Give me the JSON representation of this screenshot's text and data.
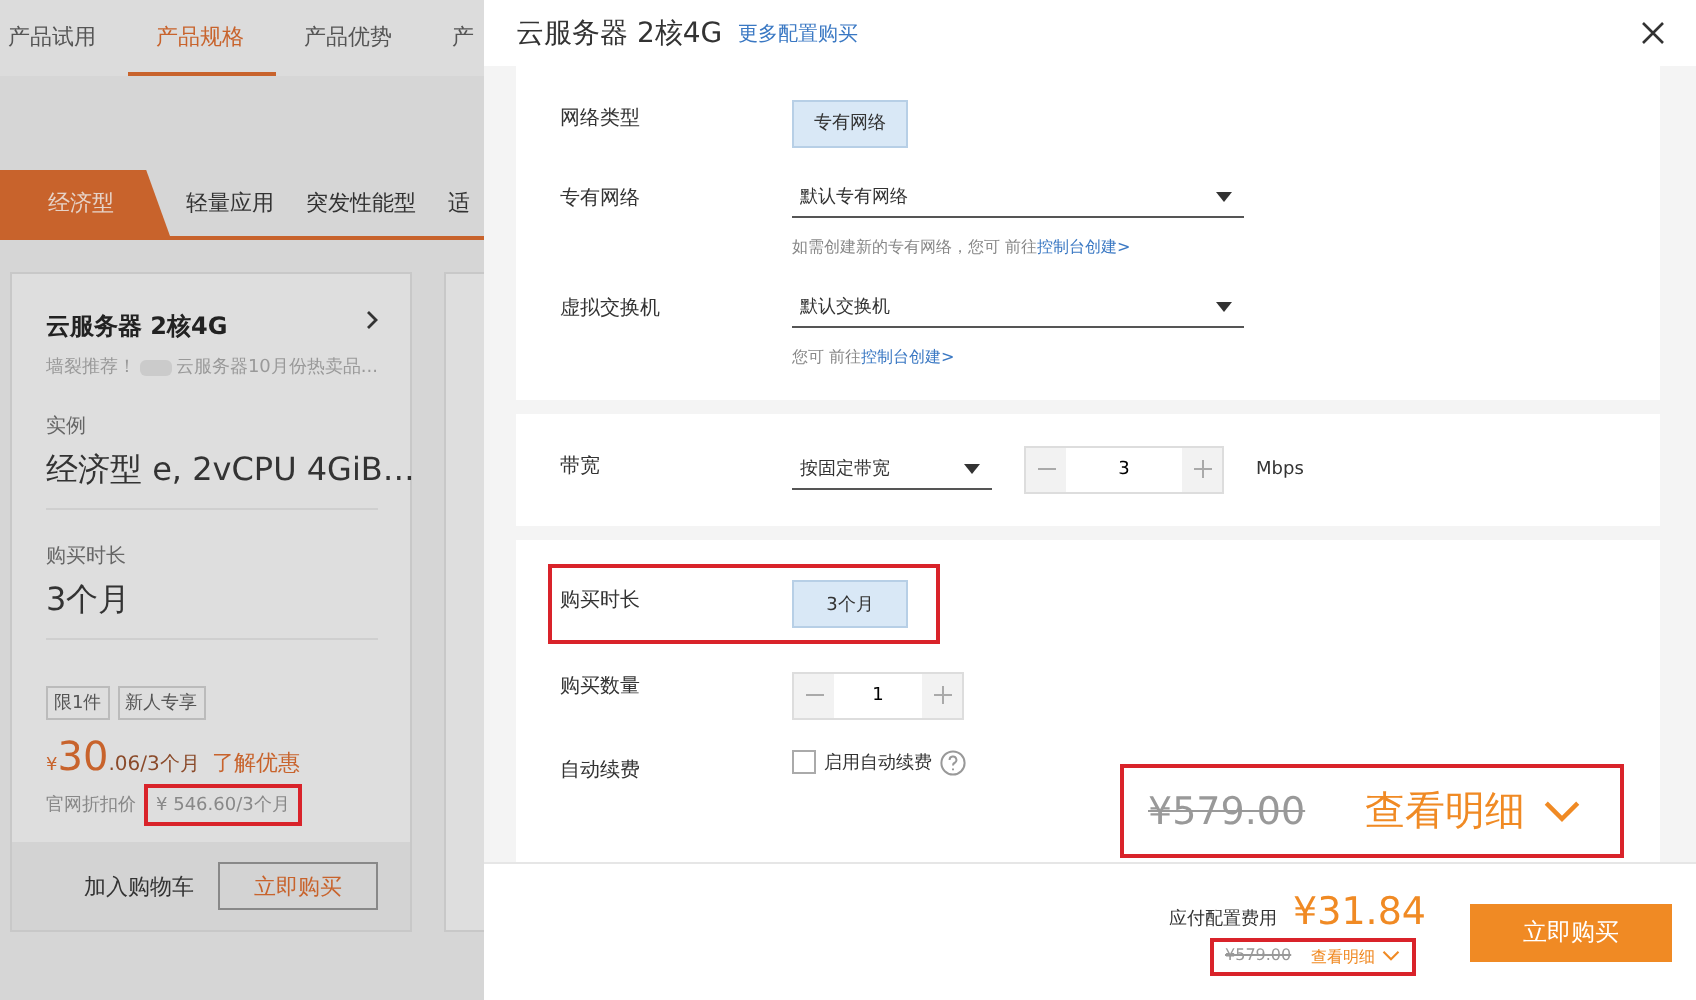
{
  "nav_tabs": [
    {
      "label": "产品试用",
      "selected": false
    },
    {
      "label": "产品规格",
      "selected": true
    },
    {
      "label": "产品优势",
      "selected": false
    },
    {
      "label": "产",
      "selected": false
    }
  ],
  "category_tabs": [
    {
      "label": "经济型",
      "selected": true
    },
    {
      "label": "轻量应用",
      "selected": false
    },
    {
      "label": "突发性能型",
      "selected": false
    },
    {
      "label": "适",
      "selected": false
    }
  ],
  "product_card": {
    "title": "云服务器 2核4G",
    "subtitle_prefix": "墙裂推荐！",
    "subtitle_suffix": "云服务器10月份热卖品...",
    "instance_label": "实例",
    "instance_value": "经济型 e, 2vCPU 4GiB…",
    "duration_label": "购买时长",
    "duration_value": "3个月",
    "tags": [
      "限1件",
      "新人专享"
    ],
    "price_currency": "¥",
    "price_integer": "30",
    "price_decimal": ".06/3个月",
    "promo_link": "了解优惠",
    "list_price_label": "官网折扣价",
    "list_price": "¥ 546.60/3个月",
    "add_to_cart": "加入购物车",
    "buy_now": "立即购买"
  },
  "dialog": {
    "title": "云服务器 2核4G",
    "more_link": "更多配置购买",
    "sections": [
      {
        "rows": [
          {
            "kind": "option",
            "label": "网络类型",
            "value": "专有网络",
            "selected": true
          },
          {
            "kind": "select",
            "label": "专有网络",
            "value": "默认专有网络",
            "hint": "如需创建新的专有网络，您可 前往",
            "hint_link": "控制台创建>"
          },
          {
            "kind": "select",
            "label": "虚拟交换机",
            "value": "默认交换机",
            "hint": "您可 前往",
            "hint_link": "控制台创建>"
          }
        ]
      },
      {
        "rows": [
          {
            "kind": "bandwidth",
            "label": "带宽",
            "value": "按固定带宽",
            "amount": "3",
            "unit": "Mbps"
          }
        ]
      },
      {
        "rows": [
          {
            "kind": "option",
            "label": "购买时长",
            "value": "3个月",
            "selected": true,
            "highlighted": true
          },
          {
            "kind": "stepper",
            "label": "购买数量",
            "amount": "1"
          },
          {
            "kind": "checkbox",
            "label": "自动续费",
            "value": "启用自动续费",
            "checked": false
          }
        ]
      }
    ],
    "footer": {
      "fee_label": "应付配置费用",
      "price": "¥31.84",
      "original_price": "¥579.00",
      "details_link": "查看明细",
      "buy_button": "立即购买"
    },
    "callout": {
      "original_price": "¥579.00",
      "details_link": "查看明细"
    }
  }
}
